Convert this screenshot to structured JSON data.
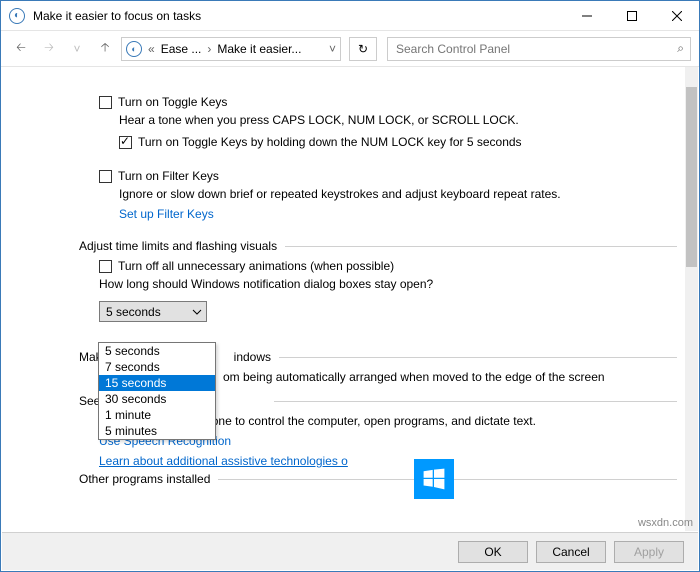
{
  "window": {
    "title": "Make it easier to focus on tasks"
  },
  "breadcrumb": {
    "b1": "Ease ...",
    "b2": "Make it easier...",
    "dots": "«"
  },
  "search": {
    "placeholder": "Search Control Panel"
  },
  "toggle_keys": {
    "label": "Turn on Toggle Keys",
    "desc": "Hear a tone when you press CAPS LOCK, NUM LOCK, or SCROLL LOCK.",
    "sub_label": "Turn on Toggle Keys by holding down the NUM LOCK key for 5 seconds"
  },
  "filter_keys": {
    "label": "Turn on Filter Keys",
    "desc": "Ignore or slow down brief or repeated keystrokes and adjust keyboard repeat rates.",
    "link": "Set up Filter Keys"
  },
  "adjust": {
    "header": "Adjust time limits and flashing visuals",
    "anim_label": "Turn off all unnecessary animations (when possible)",
    "question": "How long should Windows notification dialog boxes stay open?",
    "selected": "5 seconds"
  },
  "dd_options": {
    "o0": "5 seconds",
    "o1": "7 seconds",
    "o2": "15 seconds",
    "o3": "30 seconds",
    "o4": "1 minute",
    "o5": "5 minutes"
  },
  "manage": {
    "header_left": "Mak",
    "header_right": "indows",
    "desc_right": "om being automatically arranged when moved to the edge of the screen"
  },
  "see_also": {
    "header": "See a",
    "desc": "Speak into a microphone to control the computer, open programs, and dictate text.",
    "link1": "Use Speech Recognition",
    "link2": "Learn about additional assistive technologies o"
  },
  "other": {
    "header": "Other programs installed"
  },
  "buttons": {
    "ok": "OK",
    "cancel": "Cancel",
    "apply": "Apply"
  },
  "watermark": "wsxdn.com"
}
